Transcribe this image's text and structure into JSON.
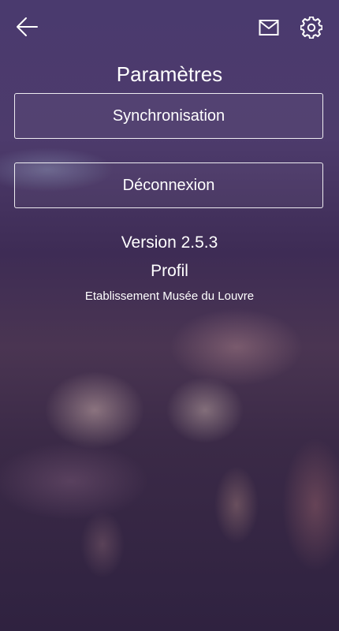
{
  "header": {
    "back_icon": "arrow-left-icon",
    "mail_icon": "mail-icon",
    "settings_icon": "gear-icon"
  },
  "page": {
    "title": "Paramètres"
  },
  "actions": {
    "sync_label": "Synchronisation",
    "logout_label": "Déconnexion"
  },
  "info": {
    "version": "Version 2.5.3",
    "profile": "Profil",
    "establishment": "Etablissement Musée du Louvre"
  },
  "colors": {
    "text": "#ffffff",
    "background": "#3b2a52"
  }
}
